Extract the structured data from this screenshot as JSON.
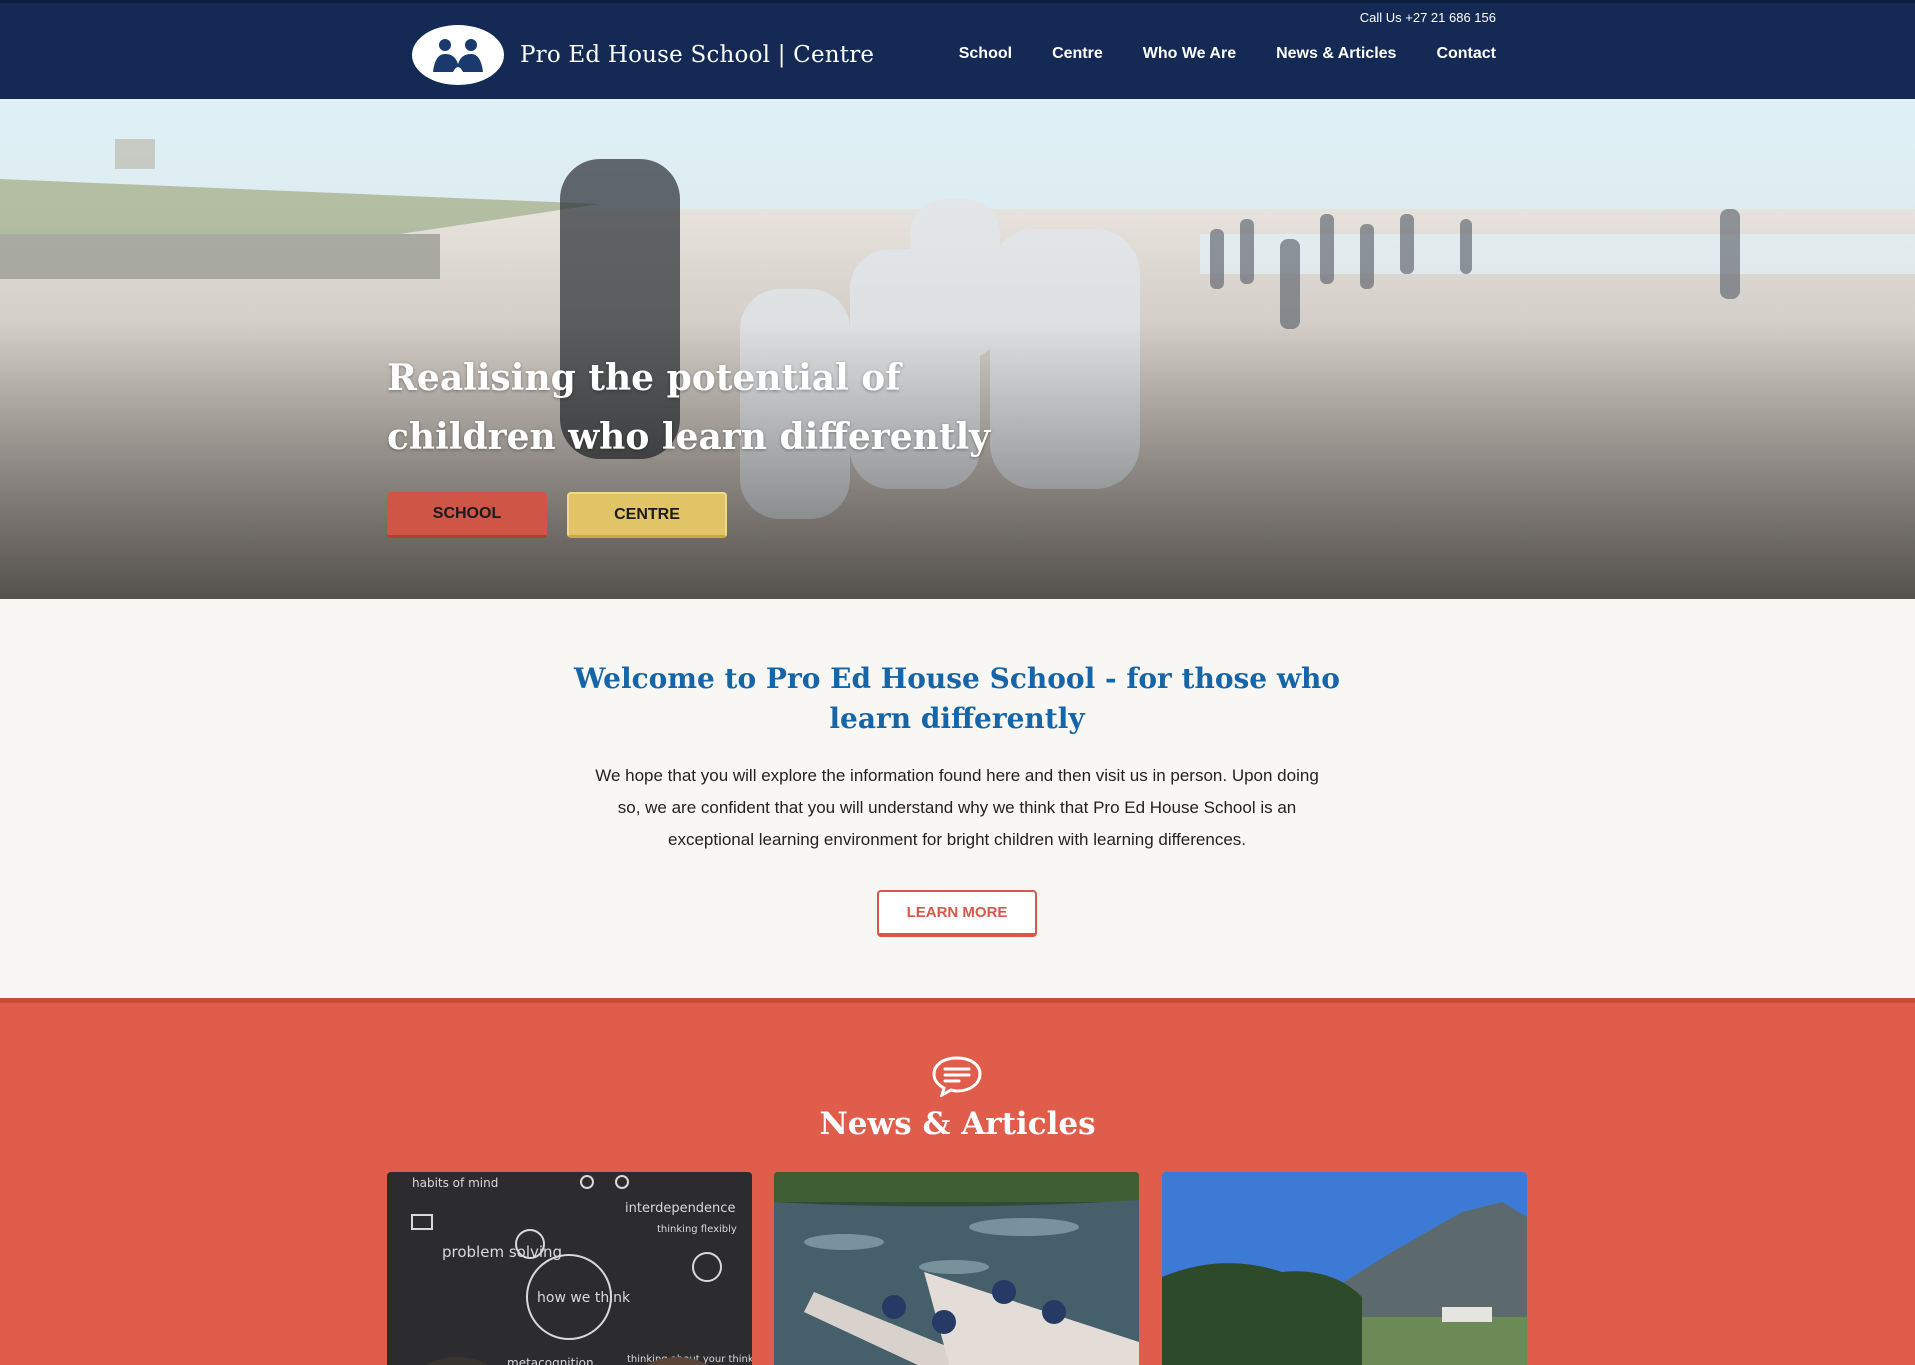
{
  "header": {
    "site_title": "Pro Ed House School | Centre",
    "phone": "Call Us +27 21 686 156",
    "nav": [
      "School",
      "Centre",
      "Who We Are",
      "News & Articles",
      "Contact"
    ]
  },
  "hero": {
    "headline": "Realising the potential of children who learn differently",
    "buttons": {
      "school": "SCHOOL",
      "centre": "CENTRE"
    }
  },
  "welcome": {
    "title": "Welcome to Pro Ed House School - for those who learn differently",
    "body": "We hope that you will explore the information found here and then visit us in person. Upon doing so, we are confident that you will understand why we think that Pro Ed House School is an exceptional learning environment for bright children with learning differences.",
    "cta": "LEARN MORE"
  },
  "news": {
    "icon": "speech-bubble-icon",
    "title": "News & Articles",
    "cards": [
      {
        "image": "chalkboard-how-we-think",
        "chalk_words": [
          "habits of mind",
          "interdependence",
          "thinking flexibly",
          "problem solving",
          "how we think",
          "metacognition",
          "thinking about your thinking"
        ]
      },
      {
        "image": "canoes-on-river"
      },
      {
        "image": "mountain-field"
      }
    ]
  },
  "colors": {
    "header_bg": "#142a55",
    "accent_red": "#df5d4a",
    "accent_gold": "#e0c466",
    "title_blue": "#1565a8"
  }
}
